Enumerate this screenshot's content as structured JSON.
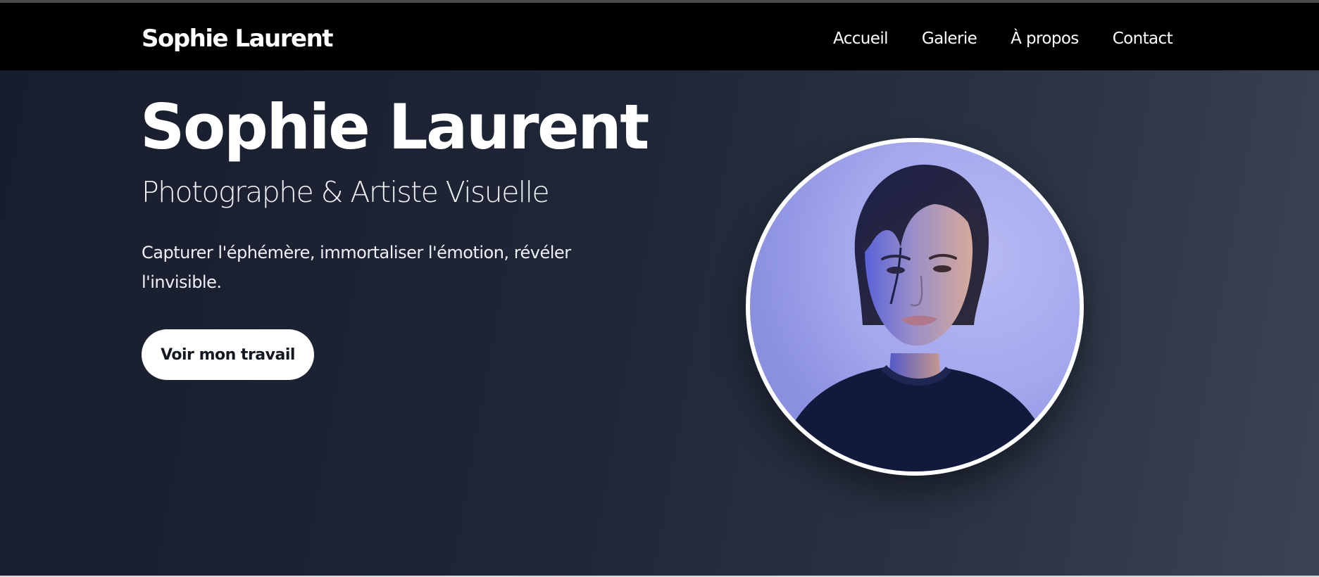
{
  "nav": {
    "brand": "Sophie Laurent",
    "links": [
      {
        "label": "Accueil"
      },
      {
        "label": "Galerie"
      },
      {
        "label": "À propos"
      },
      {
        "label": "Contact"
      }
    ]
  },
  "hero": {
    "title": "Sophie Laurent",
    "subtitle": "Photographe & Artiste Visuelle",
    "tagline": "Capturer l'éphémère, immortaliser l'émotion, révéler l'invisible.",
    "cta_label": "Voir mon travail",
    "portrait_alt": "Portrait de Sophie Laurent"
  },
  "colors": {
    "nav_background": "#000000",
    "hero_gradient_start": "#181d2d",
    "hero_gradient_end": "#3b4455",
    "portrait_backdrop": "#a3a8ec",
    "button_background": "#ffffff"
  }
}
